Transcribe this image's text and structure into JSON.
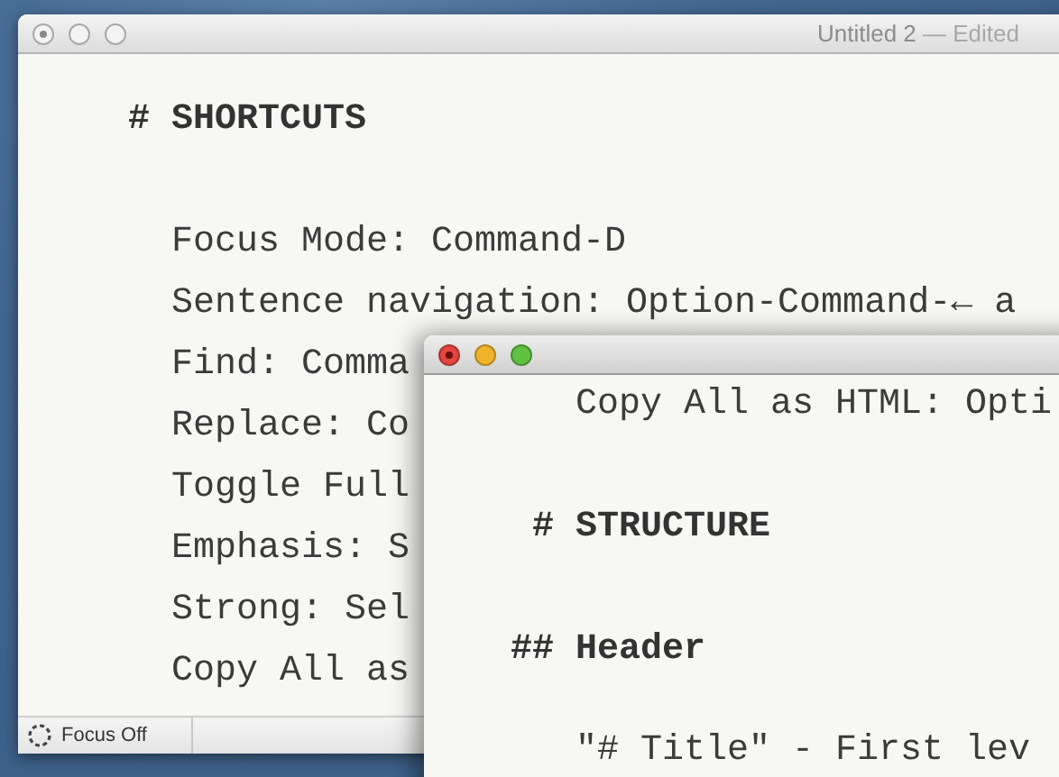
{
  "back_window": {
    "title": "Untitled 2",
    "title_suffix": "— Edited",
    "active": false,
    "edited": true,
    "lines": [
      {
        "kind": "heading",
        "marker": "#",
        "text": "SHORTCUTS"
      },
      {
        "kind": "blank"
      },
      {
        "kind": "text",
        "text": "Focus Mode: Command-D"
      },
      {
        "kind": "text",
        "text": "Sentence navigation: Option-Command-← a"
      },
      {
        "kind": "text",
        "text": "Find: Comma"
      },
      {
        "kind": "text",
        "text": "Replace: Co"
      },
      {
        "kind": "text",
        "text": "Toggle Full"
      },
      {
        "kind": "text",
        "text": "Emphasis: S"
      },
      {
        "kind": "text",
        "text": "Strong: Sel"
      },
      {
        "kind": "text",
        "text": "Copy All as"
      }
    ],
    "status_bar": {
      "focus_label": "Focus Off"
    }
  },
  "front_window": {
    "active": true,
    "lines": [
      {
        "kind": "text",
        "text": "Copy All as HTML: Opti"
      },
      {
        "kind": "blank"
      },
      {
        "kind": "heading",
        "marker": "#",
        "text": "STRUCTURE"
      },
      {
        "kind": "blank"
      },
      {
        "kind": "heading",
        "marker": "##",
        "text": "Header"
      },
      {
        "kind": "blank-short"
      },
      {
        "kind": "text",
        "text": "\"# Title\" - First lev"
      }
    ]
  }
}
